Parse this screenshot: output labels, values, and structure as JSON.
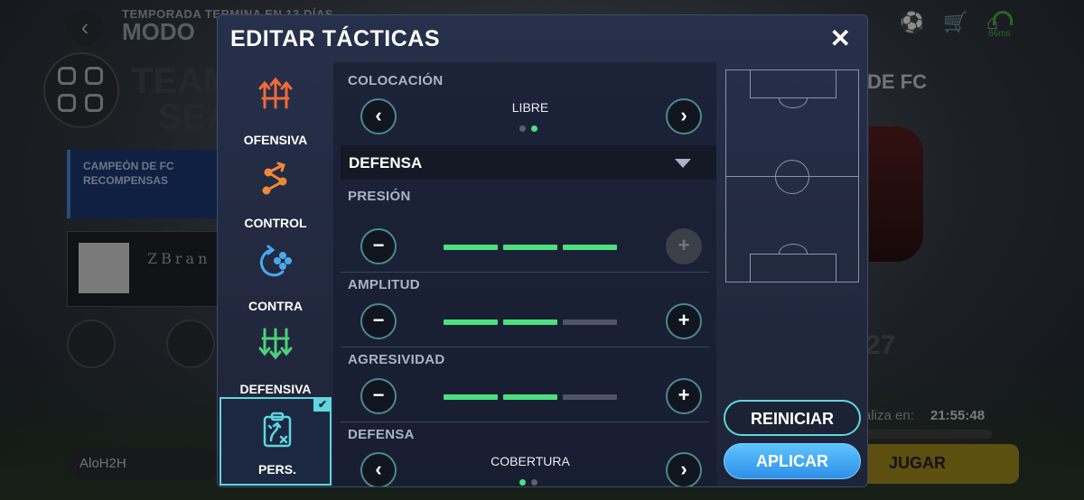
{
  "background": {
    "season_banner_small": "TEMPORADA TERMINA EN 13 DÍAS",
    "season_banner_big": "MODO",
    "team_title_line1": "TEAM",
    "team_title_line2": "SEA",
    "campeon_title": "CAMPEÓN DE FC",
    "campeon_subtitle": "RECOMPENSAS",
    "brand_text": "ZBran",
    "player_name": "AloH2H",
    "club_name": "DE FC",
    "number": "27",
    "timer_label": "aliza en:",
    "timer_value": "21:55:48",
    "play_label": "JUGAR",
    "ping": "66ms"
  },
  "modal": {
    "title": "EDITAR TÁCTICAS",
    "close": "✕",
    "presets": [
      {
        "label": "OFENSIVA"
      },
      {
        "label": "CONTROL"
      },
      {
        "label": "CONTRA"
      },
      {
        "label": "DEFENSIVA"
      },
      {
        "label": "PERS.",
        "selected": true
      }
    ],
    "colocacion": {
      "label": "COLOCACIÓN",
      "value": "LIBRE",
      "option_count": 2,
      "selected_index": 1
    },
    "dropdown": {
      "label": "DEFENSA"
    },
    "sliders": [
      {
        "label": "PRESIÓN",
        "level": 3,
        "max": 3,
        "plus_disabled": true
      },
      {
        "label": "AMPLITUD",
        "level": 2,
        "max": 3,
        "plus_disabled": false
      },
      {
        "label": "AGRESIVIDAD",
        "level": 2,
        "max": 3,
        "plus_disabled": false
      }
    ],
    "defensa_style": {
      "label": "DEFENSA",
      "value": "COBERTURA",
      "option_count": 2,
      "selected_index": 0
    },
    "buttons": {
      "reset": "REINICIAR",
      "apply": "APLICAR"
    },
    "colors": {
      "accent": "#5fd6e0",
      "bar_on": "#4ee07e",
      "apply": "#2e8fe8"
    }
  }
}
